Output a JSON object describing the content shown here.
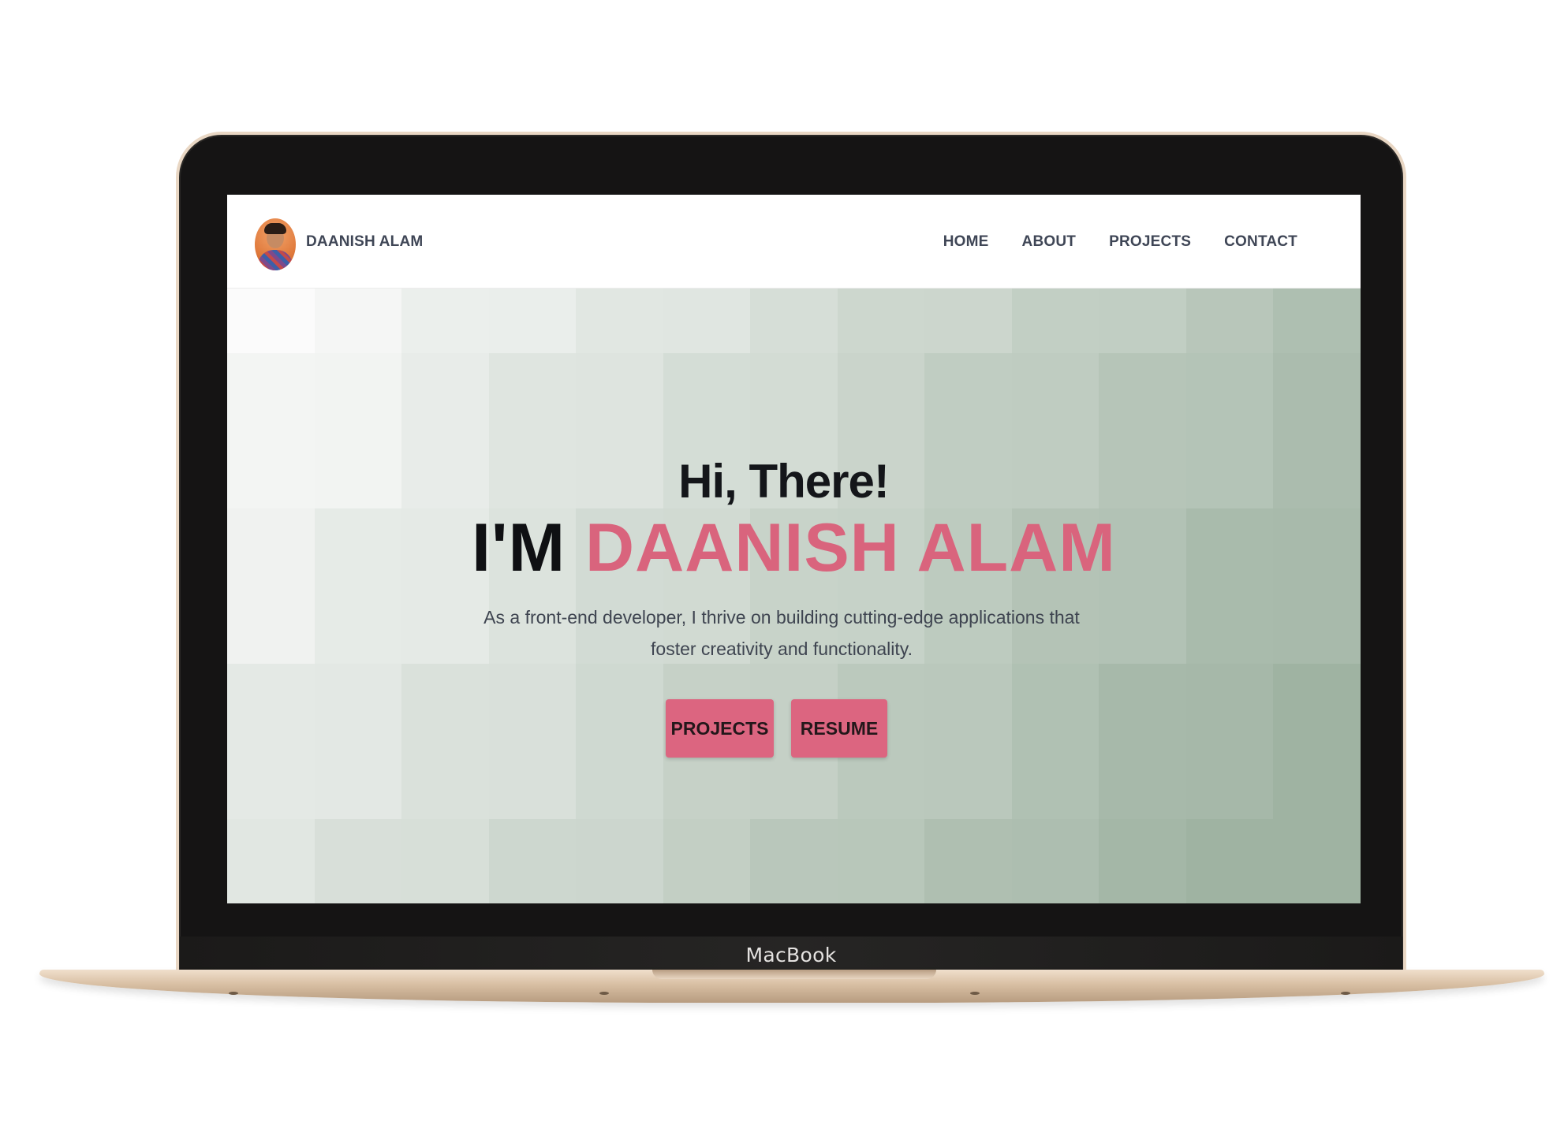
{
  "device": {
    "brand_label": "MacBook",
    "lid_color": "#151414",
    "frame_color": "#e9d7c4"
  },
  "navbar": {
    "brand": "DAANISH ALAM",
    "avatar_alt": "profile photo",
    "links": [
      {
        "label": "HOME"
      },
      {
        "label": "ABOUT"
      },
      {
        "label": "PROJECTS"
      },
      {
        "label": "CONTACT"
      }
    ]
  },
  "hero": {
    "greeting": "Hi, There!",
    "headline_prefix": "I'M",
    "headline_name": "DAANISH ALAM",
    "tagline": "As a front-end developer, I thrive on building cutting-edge applications that foster creativity and functionality.",
    "buttons": [
      {
        "label": "PROJECTS"
      },
      {
        "label": "RESUME"
      }
    ],
    "accent_color": "#d9647d",
    "background": {
      "pattern": "pixel-tile gradient",
      "light_color": "#fbfbfb",
      "dark_color": "#9fb3a2"
    }
  }
}
